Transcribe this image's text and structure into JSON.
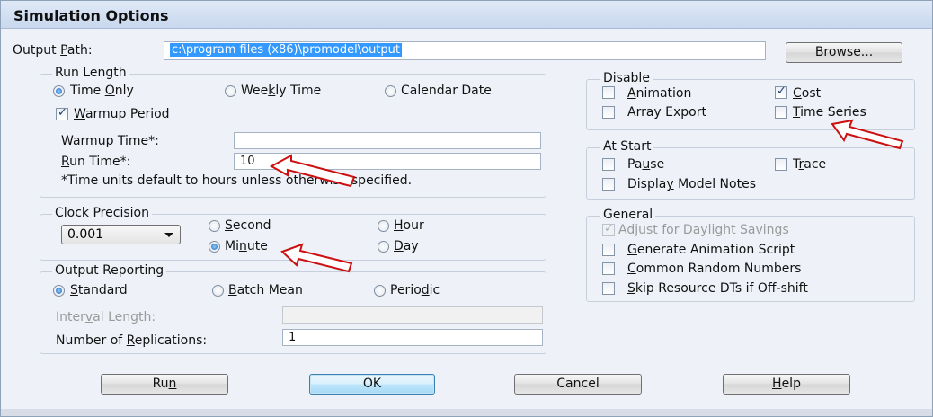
{
  "window": {
    "title": "Simulation Options"
  },
  "output_path": {
    "label_pre": "Output ",
    "label_key": "P",
    "label_post": "ath:",
    "value": "c:\\program files (x86)\\promodel\\output",
    "browse_label": "Browse..."
  },
  "run_length": {
    "title": "Run Length",
    "options": [
      {
        "pre": "Time ",
        "key": "O",
        "post": "nly",
        "selected": true
      },
      {
        "pre": "Wee",
        "key": "k",
        "post": "ly Time",
        "selected": false
      },
      {
        "pre": "Calendar Date",
        "key": "",
        "post": "",
        "selected": false
      }
    ],
    "warmup_checkbox": {
      "pre": "",
      "key": "W",
      "post": "armup Period",
      "checked": true
    },
    "warmup_time": {
      "pre": "Warm",
      "key": "u",
      "post": "p Time*:",
      "value": ""
    },
    "run_time": {
      "pre": "",
      "key": "R",
      "post": "un Time*:",
      "value": "10"
    },
    "note": "*Time units default to hours unless otherwise specified."
  },
  "clock_precision": {
    "title": "Clock Precision",
    "select_value": "0.001",
    "options": [
      {
        "pre": "",
        "key": "S",
        "post": "econd",
        "selected": false
      },
      {
        "pre": "",
        "key": "H",
        "post": "our",
        "selected": false
      },
      {
        "pre": "Mi",
        "key": "n",
        "post": "ute",
        "selected": true
      },
      {
        "pre": "",
        "key": "D",
        "post": "ay",
        "selected": false
      }
    ]
  },
  "output_reporting": {
    "title": "Output Reporting",
    "options": [
      {
        "pre": "",
        "key": "S",
        "post": "tandard",
        "selected": true
      },
      {
        "pre": "",
        "key": "B",
        "post": "atch Mean",
        "selected": false
      },
      {
        "pre": "Perio",
        "key": "d",
        "post": "ic",
        "selected": false
      }
    ],
    "interval": {
      "pre": "Inter",
      "key": "v",
      "post": "al Length:",
      "value": ""
    },
    "replications": {
      "pre": "Number of ",
      "key": "R",
      "post": "eplications:",
      "value": "1"
    }
  },
  "disable": {
    "title": "Disable",
    "items": [
      {
        "pre": "",
        "key": "A",
        "post": "nimation",
        "checked": false
      },
      {
        "pre": "",
        "key": "C",
        "post": "ost",
        "checked": true
      },
      {
        "pre": "Array Export",
        "key": "",
        "post": "",
        "checked": false
      },
      {
        "pre": "",
        "key": "T",
        "post": "ime Series",
        "checked": false
      }
    ]
  },
  "at_start": {
    "title": "At Start",
    "items": [
      {
        "pre": "Pa",
        "key": "u",
        "post": "se",
        "checked": false
      },
      {
        "pre": "T",
        "key": "r",
        "post": "ace",
        "checked": false
      },
      {
        "pre": "Displa",
        "key": "y",
        "post": " Model Notes",
        "checked": false
      }
    ]
  },
  "general": {
    "title": "General",
    "items": [
      {
        "pre": "Adjust for ",
        "key": "D",
        "post": "aylight Savings",
        "checked": true,
        "disabled": true
      },
      {
        "pre": "",
        "key": "G",
        "post": "enerate Animation Script",
        "checked": false,
        "disabled": false
      },
      {
        "pre": "",
        "key": "C",
        "post": "ommon Random Numbers",
        "checked": false,
        "disabled": false
      },
      {
        "pre": "",
        "key": "S",
        "post": "kip Resource DTs if Off-shift",
        "checked": false,
        "disabled": false
      }
    ]
  },
  "buttons": {
    "run": {
      "pre": "Ru",
      "key": "n",
      "post": ""
    },
    "ok": "OK",
    "cancel": "Cancel",
    "help": {
      "pre": "",
      "key": "H",
      "post": "elp"
    }
  },
  "annotation_colors": {
    "arrow_stroke": "#cc1010",
    "arrow_fill": "#ffffff"
  }
}
